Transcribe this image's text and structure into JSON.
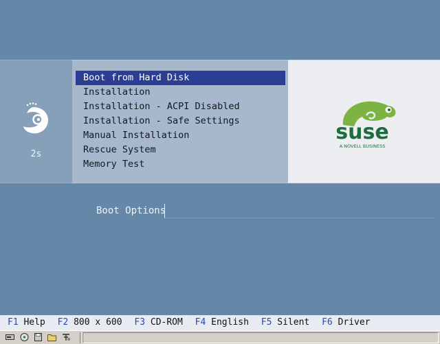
{
  "menu": {
    "items": [
      {
        "label": "Boot from Hard Disk",
        "selected": true
      },
      {
        "label": "Installation",
        "selected": false
      },
      {
        "label": "Installation - ACPI Disabled",
        "selected": false
      },
      {
        "label": "Installation - Safe Settings",
        "selected": false
      },
      {
        "label": "Manual Installation",
        "selected": false
      },
      {
        "label": "Rescue System",
        "selected": false
      },
      {
        "label": "Memory Test",
        "selected": false
      }
    ]
  },
  "timer": "2s",
  "logo": {
    "wordmark": "suse",
    "tagline": "A NOVELL BUSINESS",
    "color": "#1e6d3e",
    "accent": "#7cb342"
  },
  "boot_options": {
    "label": "Boot Options",
    "value": ""
  },
  "fkeys": [
    {
      "key": "F1",
      "label": "Help"
    },
    {
      "key": "F2",
      "label": "800 x 600"
    },
    {
      "key": "F3",
      "label": "CD-ROM"
    },
    {
      "key": "F4",
      "label": "English"
    },
    {
      "key": "F5",
      "label": "Silent"
    },
    {
      "key": "F6",
      "label": "Driver"
    }
  ],
  "taskbar": {
    "icons": [
      "drive-icon",
      "cd-icon",
      "floppy-icon",
      "folder-icon",
      "tools-icon"
    ]
  },
  "colors": {
    "background": "#6688a8",
    "selection": "#2c3e94",
    "fkey": "#2848b0"
  }
}
